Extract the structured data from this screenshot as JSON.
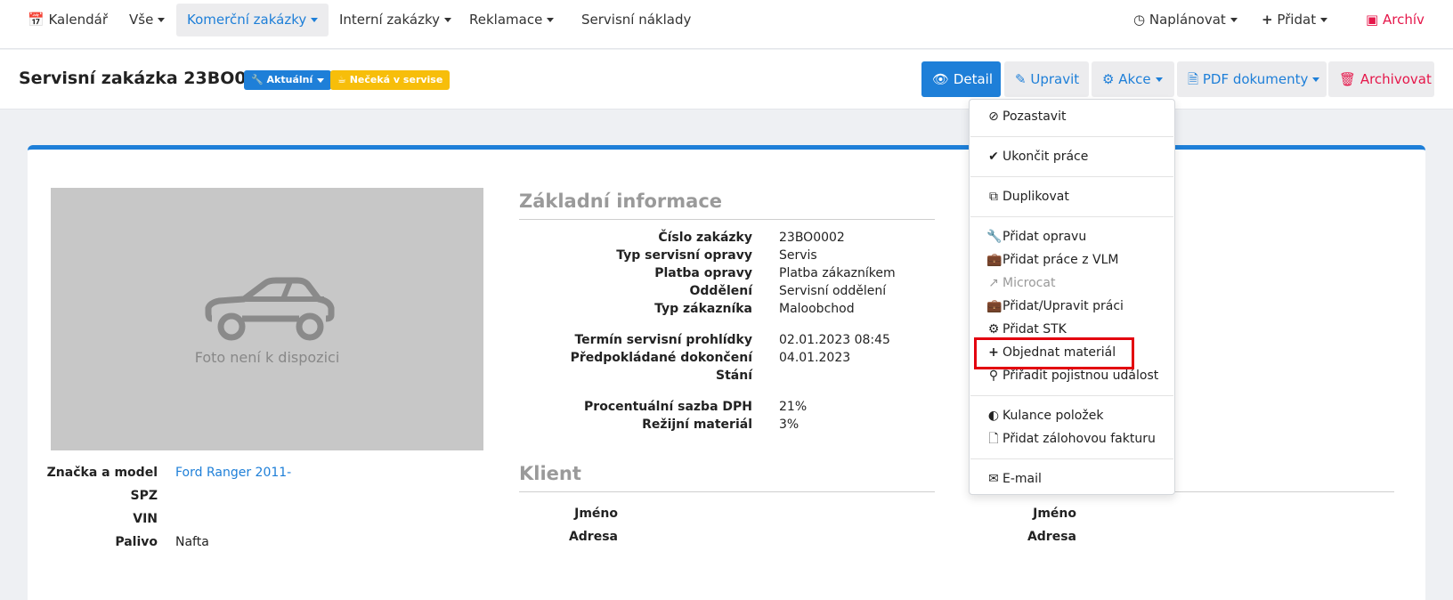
{
  "nav": {
    "kalendar": "Kalendář",
    "vse": "Vše",
    "komercni": "Komerční zakázky",
    "interni": "Interní zakázky",
    "reklamace": "Reklamace",
    "servisni_naklady": "Servisní náklady",
    "naplanovat": "Naplánovat",
    "pridat": "Přidat",
    "archiv": "Archív"
  },
  "header": {
    "title": "Servisní zakázka 23BO0002",
    "badge_status": "Aktuální",
    "badge_waiting": "Nečeká v servise",
    "btn_detail": "Detail",
    "btn_upravit": "Upravit",
    "btn_akce": "Akce",
    "btn_pdf": "PDF dokumenty",
    "btn_archivovat": "Archivovat"
  },
  "vehicle": {
    "photo_placeholder": "Foto není k dispozici",
    "model_label": "Značka a model",
    "model_value": "Ford Ranger 2011-",
    "spz_label": "SPZ",
    "vin_label": "VIN",
    "palivo_label": "Palivo",
    "palivo_value": "Nafta"
  },
  "basic": {
    "title": "Základní informace",
    "rows": [
      {
        "label": "Číslo zakázky",
        "value": "23BO0002"
      },
      {
        "label": "Typ servisní opravy",
        "value": "Servis"
      },
      {
        "label": "Platba opravy",
        "value": "Platba zákazníkem"
      },
      {
        "label": "Oddělení",
        "value": "Servisní oddělení"
      },
      {
        "label": "Typ zákazníka",
        "value": "Maloobchod"
      },
      {
        "label": "Termín servisní prohlídky",
        "value": "02.01.2023 08:45"
      },
      {
        "label": "Předpokládané dokončení",
        "value": "04.01.2023"
      },
      {
        "label": "Stání",
        "value": ""
      },
      {
        "label": "Procentuální sazba DPH",
        "value": "21%"
      },
      {
        "label": "Režijní materiál",
        "value": "3%"
      }
    ]
  },
  "client": {
    "title": "Klient",
    "jmeno_label": "Jméno",
    "adresa_label": "Adresa",
    "jmeno2_label": "Jméno",
    "adresa2_label": "Adresa"
  },
  "menu": {
    "items": [
      {
        "label": "Pozastavit"
      },
      {
        "label": "Ukončit práce"
      },
      {
        "label": "Duplikovat"
      },
      {
        "label": "Přidat opravu"
      },
      {
        "label": "Přidat práce z VLM"
      },
      {
        "label": "Microcat"
      },
      {
        "label": "Přidat/Upravit práci"
      },
      {
        "label": "Přidat STK"
      },
      {
        "label": "Objednat materiál"
      },
      {
        "label": "Přiřadit pojistnou událost"
      },
      {
        "label": "Kulance položek"
      },
      {
        "label": "Přidat zálohovou fakturu"
      },
      {
        "label": "E-mail"
      }
    ]
  },
  "colors": {
    "primary": "#1e7fd8",
    "danger": "#e5174a",
    "warning": "#f7be0a",
    "highlight": "#e3000f"
  }
}
